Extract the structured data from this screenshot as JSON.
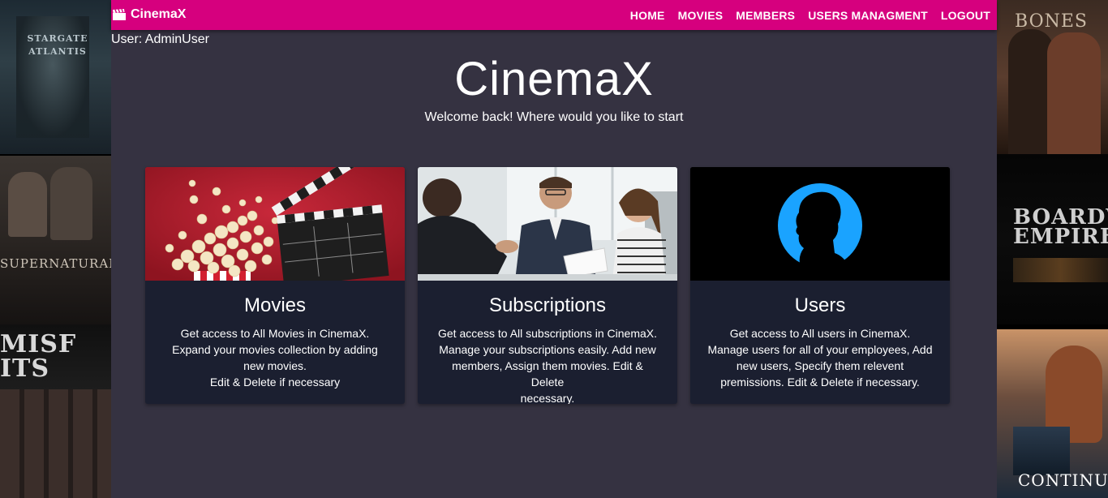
{
  "brand": {
    "name": "CinemaX",
    "icon": "clapperboard-icon"
  },
  "nav": {
    "links": [
      {
        "label": "HOME"
      },
      {
        "label": "MOVIES"
      },
      {
        "label": "MEMBERS"
      },
      {
        "label": "USERS MANAGMENT"
      },
      {
        "label": "LOGOUT"
      }
    ]
  },
  "user": {
    "label": "User: AdminUser"
  },
  "hero": {
    "title": "CinemaX",
    "subtitle": "Welcome back! Where would you like to start"
  },
  "cards": [
    {
      "title": "Movies",
      "lines": [
        "Get access to All Movies in CinemaX.",
        "Expand your movies collection by adding",
        "new movies.",
        "Edit & Delete if necessary"
      ],
      "image": "popcorn-clapperboard-image"
    },
    {
      "title": "Subscriptions",
      "lines": [
        "Get access to All subscriptions in CinemaX.",
        "Manage your subscriptions easily. Add new",
        "members, Assign them movies. Edit & Delete",
        "necessary."
      ],
      "image": "handshake-meeting-image"
    },
    {
      "title": "Users",
      "lines": [
        "Get access to All users in CinemaX.",
        "Manage users for all of your employees, Add",
        "new users, Specify them relevent",
        "premissions. Edit & Delete if necessary."
      ],
      "image": "user-silhouette-image"
    }
  ],
  "background_posters": {
    "left": [
      "STARGATE ATLANTIS",
      "SUPERNATURAL",
      "MISFITS"
    ],
    "right": [
      "BONES",
      "BOARDWALK EMPIRE",
      "CONTINUUM"
    ]
  },
  "colors": {
    "navbar": "#d6007e",
    "page": "#353241",
    "card": "#1b1f30",
    "user_circle": "#1aa3ff"
  }
}
